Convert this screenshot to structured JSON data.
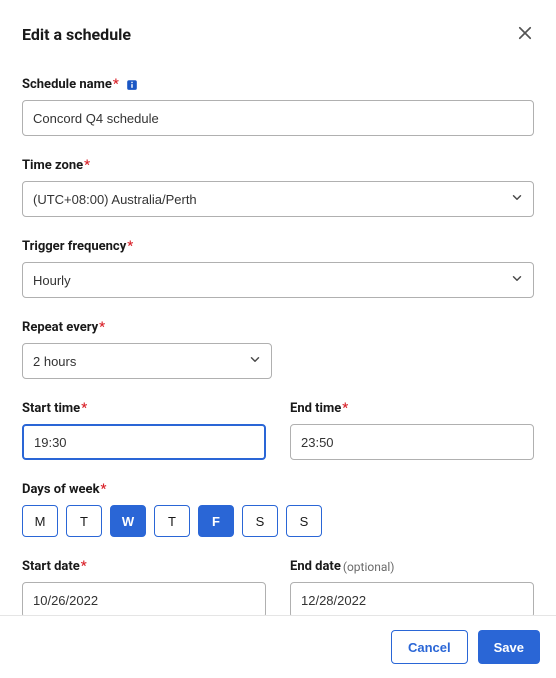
{
  "header": {
    "title": "Edit a schedule"
  },
  "fields": {
    "schedule_name": {
      "label": "Schedule name",
      "value": "Concord Q4 schedule"
    },
    "time_zone": {
      "label": "Time zone",
      "value": "(UTC+08:00) Australia/Perth"
    },
    "trigger_frequency": {
      "label": "Trigger frequency",
      "value": "Hourly"
    },
    "repeat_every": {
      "label": "Repeat every",
      "value": "2 hours"
    },
    "start_time": {
      "label": "Start time",
      "value": "19:30"
    },
    "end_time": {
      "label": "End time",
      "value": "23:50"
    },
    "days_of_week": {
      "label": "Days of week",
      "days": [
        {
          "abbr": "M",
          "selected": false
        },
        {
          "abbr": "T",
          "selected": false
        },
        {
          "abbr": "W",
          "selected": true
        },
        {
          "abbr": "T",
          "selected": false
        },
        {
          "abbr": "F",
          "selected": true
        },
        {
          "abbr": "S",
          "selected": false
        },
        {
          "abbr": "S",
          "selected": false
        }
      ]
    },
    "start_date": {
      "label": "Start date",
      "value": "10/26/2022"
    },
    "end_date": {
      "label": "End date",
      "optional_text": "(optional)",
      "value": "12/28/2022"
    }
  },
  "footer": {
    "cancel": "Cancel",
    "save": "Save"
  }
}
